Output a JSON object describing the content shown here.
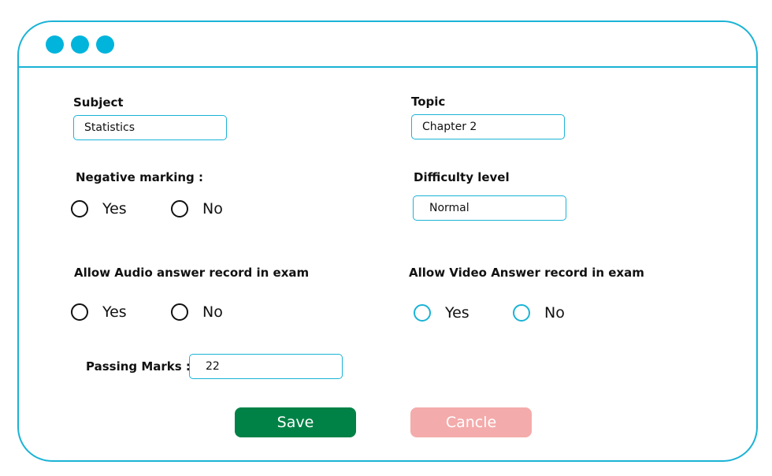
{
  "subject": {
    "label": "Subject",
    "value": "Statistics"
  },
  "topic": {
    "label": "Topic",
    "value": "Chapter 2"
  },
  "negative_marking": {
    "label": "Negative marking :",
    "options": [
      "Yes",
      "No"
    ]
  },
  "difficulty": {
    "label": "Difficulty level",
    "value": "Normal"
  },
  "audio_answer": {
    "label": "Allow Audio answer record in exam",
    "options": [
      "Yes",
      "No"
    ]
  },
  "video_answer": {
    "label": "Allow Video Answer record in exam",
    "options": [
      "Yes",
      "No"
    ]
  },
  "passing_marks": {
    "label": "Passing Marks :",
    "value": "22"
  },
  "buttons": {
    "save": "Save",
    "cancel": "Cancle"
  },
  "colors": {
    "accent": "#1ab3d6",
    "dots": "#00b4dc",
    "save": "#008246",
    "cancel": "#f4abab"
  },
  "icons": {
    "window_controls": "window-dot-icon",
    "radio": "radio-unchecked-icon"
  }
}
